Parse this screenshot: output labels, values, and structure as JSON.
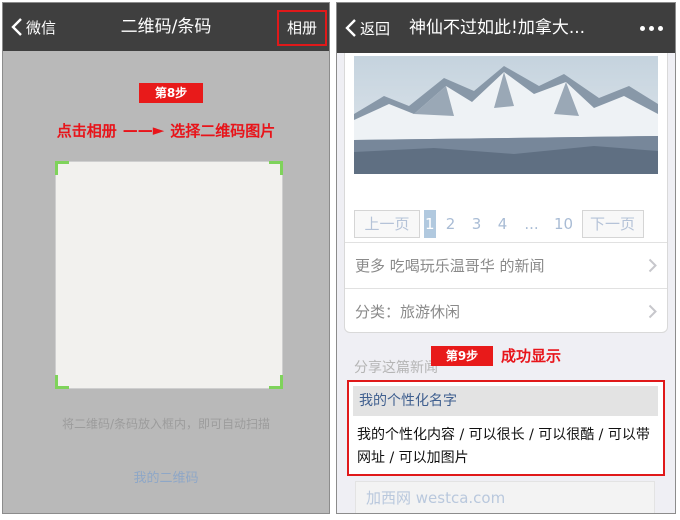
{
  "left": {
    "nav": {
      "back_label": "微信",
      "title": "二维码/条码",
      "album_button": "相册"
    },
    "step_badge": "第8步",
    "instruction": {
      "part1": "点击相册",
      "arrow": "——►",
      "part2": "选择二维码图片"
    },
    "scan_hint": "将二维码/条码放入框内，即可自动扫描",
    "my_qr_link": "我的二维码"
  },
  "right": {
    "nav": {
      "back_label": "返回",
      "title": "神仙不过如此!加拿大...",
      "more_icon": "more-dots-icon"
    },
    "pagination": {
      "prev": "上一页",
      "pages": [
        "1",
        "2",
        "3",
        "4",
        "...",
        "10"
      ],
      "current": "1",
      "next": "下一页"
    },
    "rows": [
      {
        "label": "更多 吃喝玩乐温哥华 的新闻"
      },
      {
        "label": "分类：旅游休闲"
      }
    ],
    "share_label": "分享这篇新闻",
    "step_badge": "第9步",
    "success_text": "成功显示",
    "highlight": {
      "name": "我的个性化名字",
      "content": "我的个性化内容 / 可以很长 / 可以很酷 / 可以带网址 / 可以加图片"
    },
    "footer_link": "加西网 westca.com"
  },
  "colors": {
    "nav_bg": "#3e3e3e",
    "annotation_red": "#e8141a",
    "scan_corner_green": "#7fd35b",
    "link_blue": "#3f5f8f"
  }
}
